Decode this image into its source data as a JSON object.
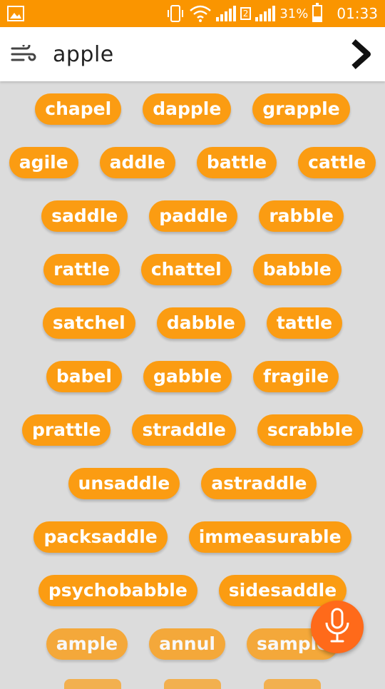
{
  "status_bar": {
    "sim_badge": "2",
    "battery": "31%",
    "battery_level": 0.31,
    "time": "01:33",
    "icons": [
      "gallery-icon",
      "vibrate-icon",
      "wifi-icon",
      "signal-icon-1",
      "signal-icon-2",
      "battery-icon"
    ]
  },
  "search": {
    "query": "apple",
    "menu_icon": "wind-menu-icon",
    "go_icon": "chevron-right-icon"
  },
  "rows": [
    [
      "chapel",
      "dapple",
      "grapple"
    ],
    [
      "agile",
      "addle",
      "battle",
      "cattle"
    ],
    [
      "saddle",
      "paddle",
      "rabble"
    ],
    [
      "rattle",
      "chattel",
      "babble"
    ],
    [
      "satchel",
      "dabble",
      "tattle"
    ],
    [
      "babel",
      "gabble",
      "fragile"
    ],
    [
      "prattle",
      "straddle",
      "scrabble"
    ],
    [
      "unsaddle",
      "astraddle"
    ],
    [
      "packsaddle",
      "immeasurable"
    ],
    [
      "psychobabble",
      "sidesaddle"
    ],
    [
      "ample",
      "annul",
      "sample"
    ]
  ],
  "mic_icon": "microphone-icon",
  "colors": {
    "accent": "#fa9500",
    "chip": "#fb9c12",
    "mic": "#ff6a1a",
    "background": "#dcdcdc"
  }
}
